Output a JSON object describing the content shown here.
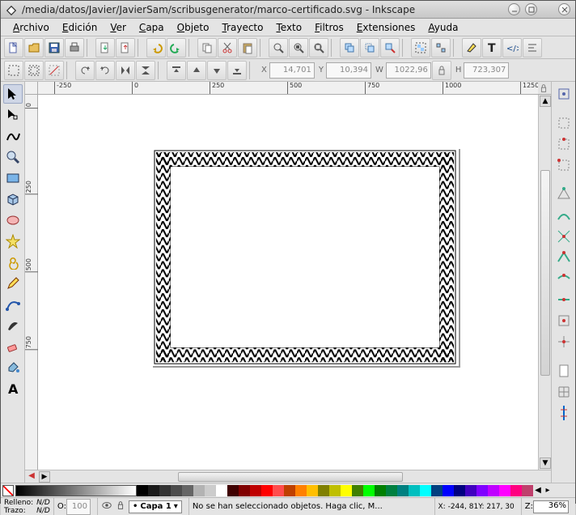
{
  "title": "/media/datos/Javier/JavierSam/scribusgenerator/marco-certificado.svg - Inkscape",
  "menus": [
    "Archivo",
    "Edición",
    "Ver",
    "Capa",
    "Objeto",
    "Trayecto",
    "Texto",
    "Filtros",
    "Extensiones",
    "Ayuda"
  ],
  "coord_bar": {
    "x_label": "X",
    "x": "14,701",
    "y_label": "Y",
    "y": "10,394",
    "w_label": "W",
    "w": "1022,96",
    "h_label": "H",
    "h": "723,307"
  },
  "ruler_h": [
    "-250",
    "0",
    "250",
    "500",
    "750",
    "1000",
    "1250"
  ],
  "ruler_v": [
    "0",
    "250",
    "500",
    "750"
  ],
  "palette": [
    "#000000",
    "#1a1a1a",
    "#333333",
    "#4d4d4d",
    "#666666",
    "#b3b3b3",
    "#cccccc",
    "#ffffff",
    "#3f0000",
    "#800000",
    "#bf0000",
    "#ff0000",
    "#ff4d4d",
    "#bf4000",
    "#ff8000",
    "#ffbf00",
    "#808000",
    "#bfbf00",
    "#ffff00",
    "#408000",
    "#00ff00",
    "#008000",
    "#008040",
    "#008080",
    "#00bfbf",
    "#00ffff",
    "#004080",
    "#0000ff",
    "#000080",
    "#4000bf",
    "#8000ff",
    "#bf00ff",
    "#ff00ff",
    "#ff0080",
    "#bf406c"
  ],
  "status": {
    "fill_label": "Relleno:",
    "stroke_label": "Trazo:",
    "fill_value": "N/D",
    "stroke_value": "N/D",
    "opacity_label": "O:",
    "opacity_value": "100",
    "layer_value": "Capa 1",
    "hint": "No se han seleccionado objetos. Haga clic, M...",
    "cursor_x_label": "X:",
    "cursor_x": "-244, 81",
    "cursor_y_label": "Y:",
    "cursor_y": "217, 30",
    "zoom_label": "Z:",
    "zoom": "36%"
  }
}
